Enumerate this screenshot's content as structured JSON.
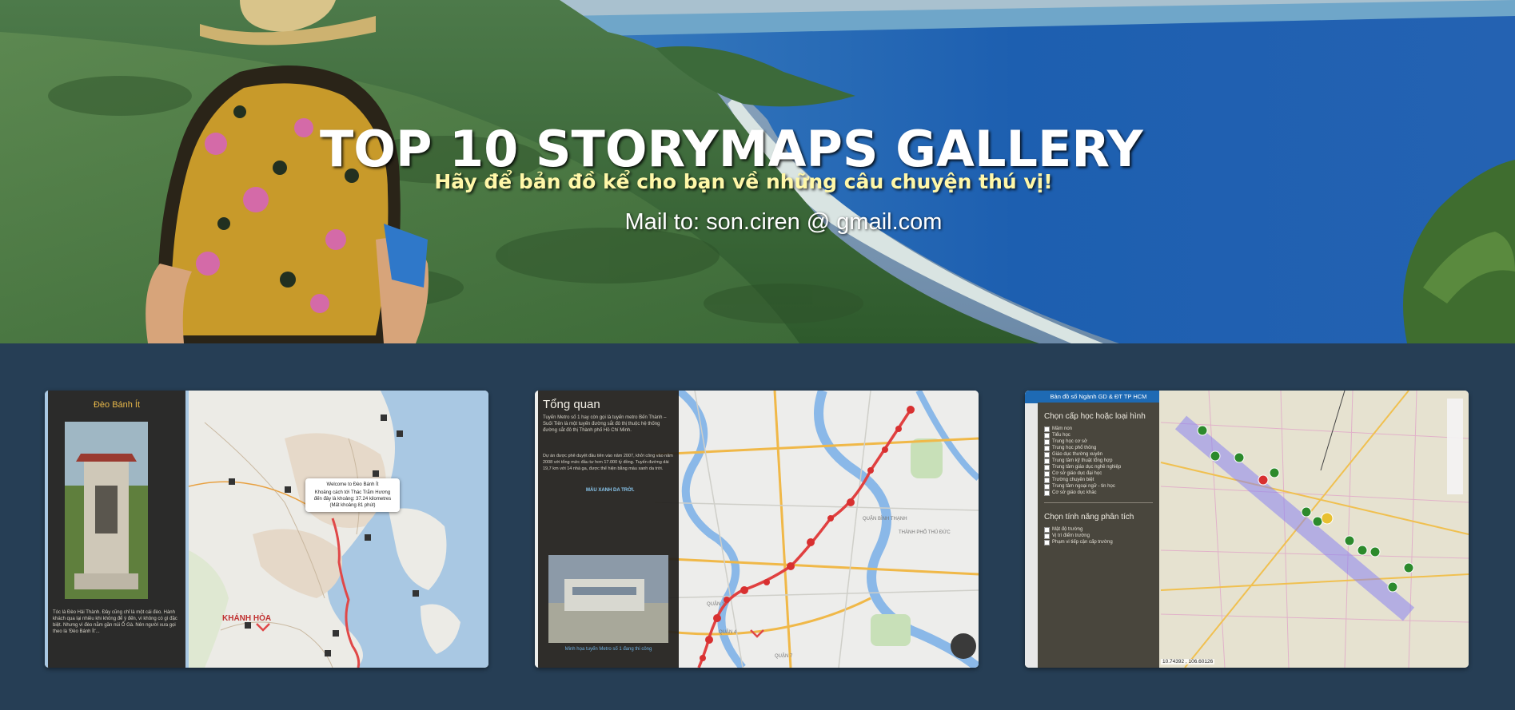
{
  "hero": {
    "title": "TOP 10 STORYMAPS GALLERY",
    "subtitle": "Hãy để bản đồ kể cho bạn về những câu chuyện thú vị!",
    "mail": "Mail to: son.ciren @ gmail.com"
  },
  "cards": [
    {
      "panel_title": "Đèo Bánh Ít",
      "popup_heading": "Welcome to Đèo Bánh Ít",
      "popup_text": "Khoảng cách tới Thác Trắm Hương đến đây là khoảng: 37.24 kilometres (Mất khoảng 81 phút)",
      "map_label": "KHÁNH HÒA",
      "caption": "Tóc là Đèo Hải Thành. Đây cũng chỉ là một cái đèo. Hành khách qua lại nhiều khi không để ý đến, vì không có gì đặc biệt. Nhưng vì đèo nằm gần núi Ổ Gà. Nên người xưa gọi theo là 'Đèo Bánh Ít'..."
    },
    {
      "panel_title": "Tổng quan",
      "paragraph_1": "Tuyến Metro số 1 hay còn gọi là tuyến metro Bến Thành – Suối Tiên là một tuyến đường sắt đô thị thuộc hệ thống đường sắt đô thị Thành phố Hồ Chí Minh.",
      "paragraph_2": "Dự án được phê duyệt đầu tiên vào năm 2007, khởi công vào năm 2008 với tổng mức đầu tư hơn 17.000 tỷ đồng. Tuyến đường dài 19,7 km với 14 nhà ga, được thể hiện bằng màu xanh da trời.",
      "highlight": "MÀU XANH DA TRỜI.",
      "photo_caption": "Minh họa tuyến Metro số 1 đang thi công",
      "map_labels": [
        "QUẬN BÌNH THẠNH",
        "THÀNH PHỐ THỦ ĐỨC",
        "QUẬN 1",
        "QUẬN 4",
        "QUẬN 7"
      ]
    },
    {
      "header": "Bản đồ số Ngành GD & ĐT TP HCM",
      "section_1": "Chọn cấp học hoặc loại hình",
      "section_2": "Chọn tính năng phân tích",
      "layers_1": [
        "Mầm non",
        "Tiểu học",
        "Trung học cơ sở",
        "Trung học phổ thông",
        "Giáo dục thường xuyên",
        "Trung tâm kỹ thuật tổng hợp",
        "Trung tâm giáo dục nghề nghiệp",
        "Cơ sở giáo dục đại học",
        "Trường chuyên biệt",
        "Trung tâm ngoại ngữ - tin học",
        "Cơ sở giáo dục khác"
      ],
      "layers_2": [
        "Mật độ trường",
        "Vị trí điểm trường",
        "Phạm vi tiếp cận cấp trường"
      ],
      "coords": "10.74392 , 106.60126"
    }
  ]
}
